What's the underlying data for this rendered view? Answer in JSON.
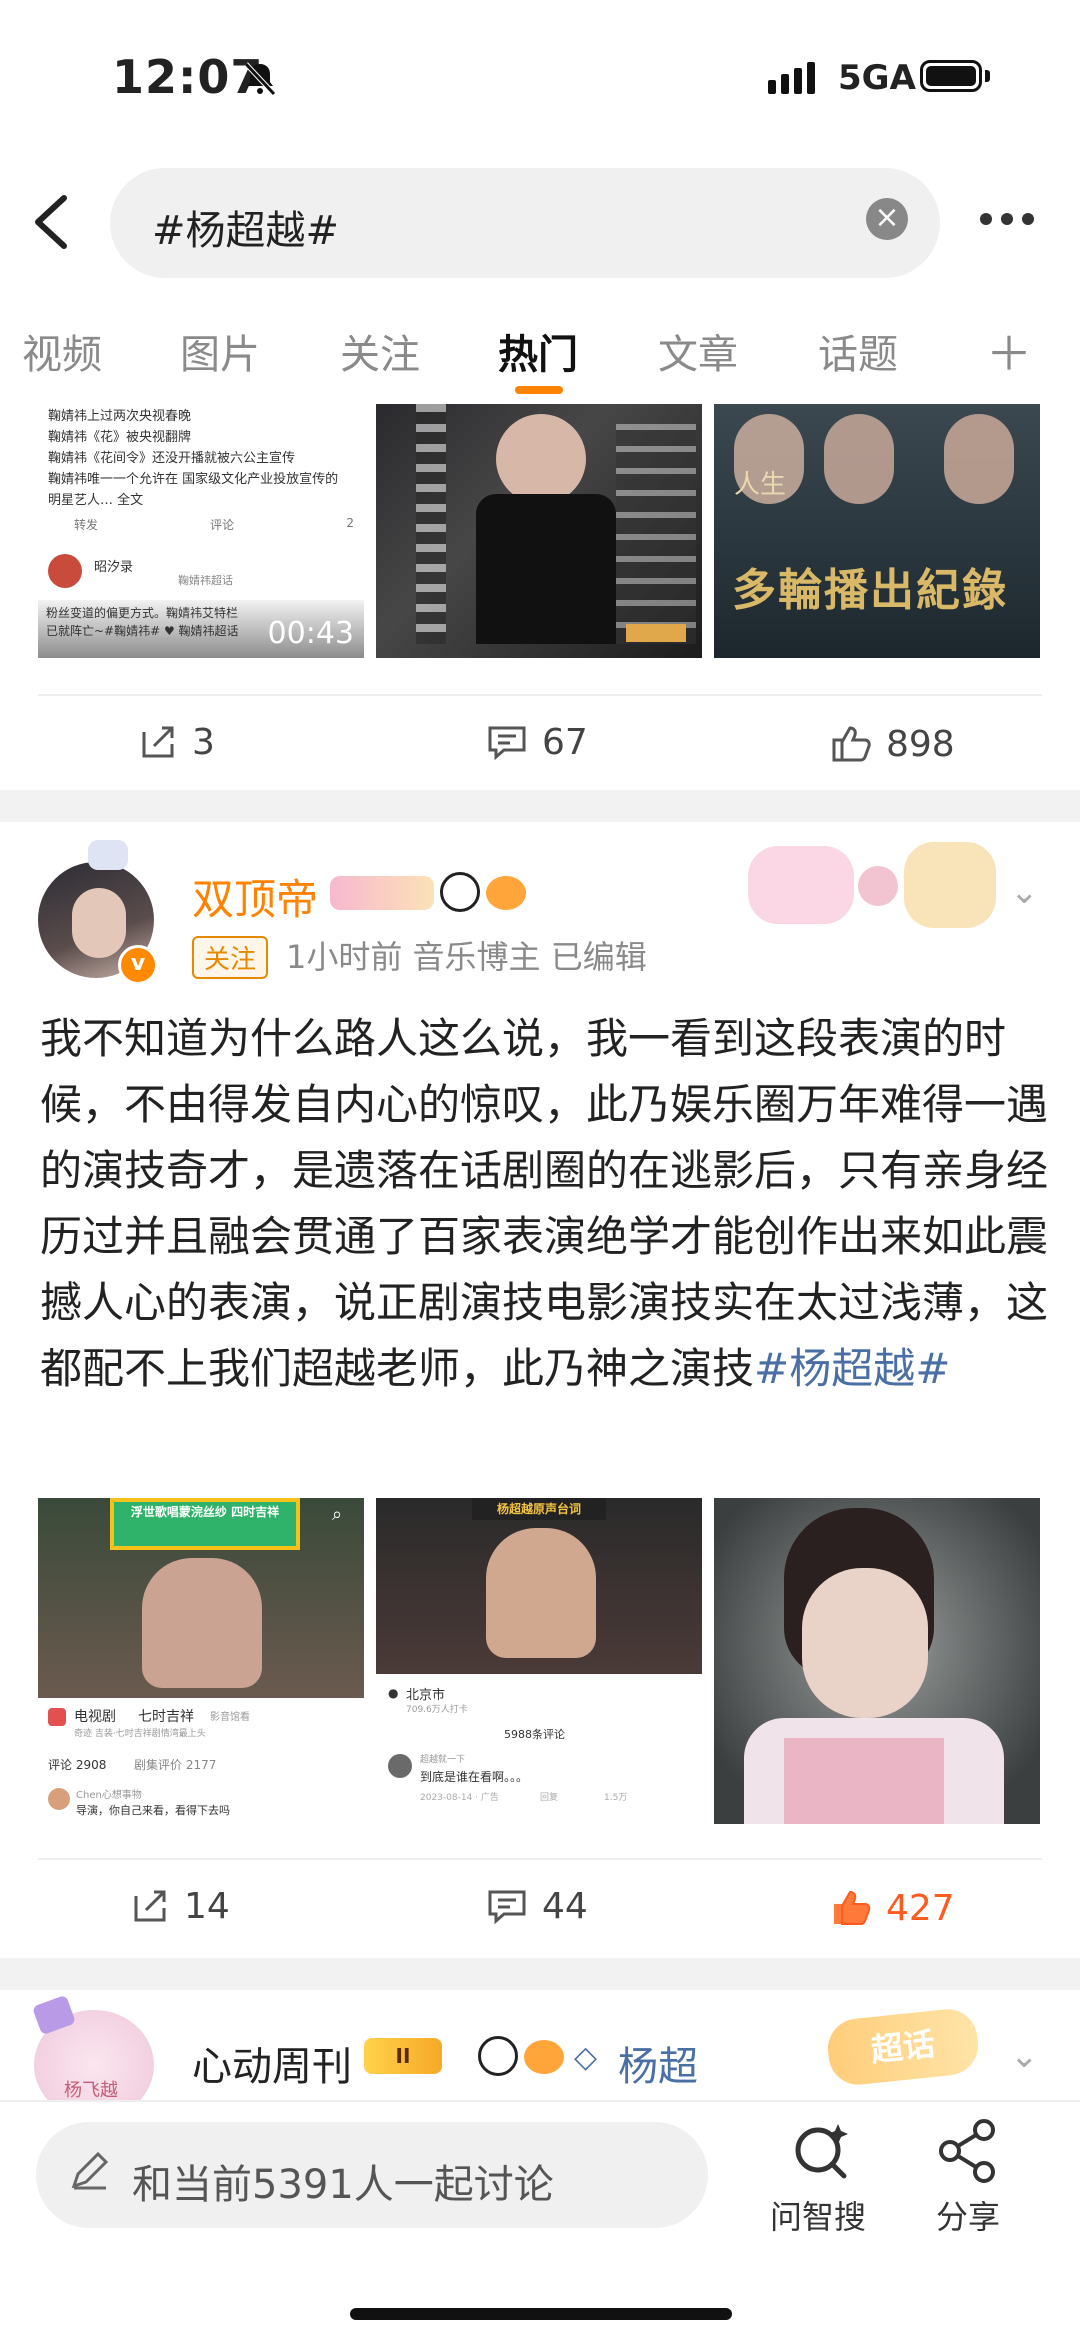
{
  "status": {
    "time": "12:07",
    "network": "5GA"
  },
  "search": {
    "query": "#杨超越#"
  },
  "tabs": [
    "视频",
    "图片",
    "关注",
    "热门",
    "文章",
    "话题"
  ],
  "active_tab": "热门",
  "post1": {
    "video_lines": [
      "鞠婧祎上过两次央视春晚",
      "鞠婧祎《花》被央视翻牌",
      "鞠婧祎《花间令》还没开播就被六公主宣传",
      "鞠婧祎唯一一个允许在 国家级文化产业投放宣传的",
      "明星艺人… 全文"
    ],
    "video_actions": [
      "转发",
      "评论",
      "2"
    ],
    "video_user": "昭汐录",
    "video_supertopic": "鞠婧祎超话",
    "video_caption": "粉丝变道的偏更方式。鞠婧祎艾特栏已就阵亡~#鞠婧祎# ♥ 鞠婧祎超话",
    "video_duration": "00:43",
    "poster_title": "多輪播出紀錄",
    "poster_subtitle": "人生",
    "actions": {
      "repost": "3",
      "comment": "67",
      "like": "898"
    }
  },
  "post2": {
    "username": "双顶帝",
    "follow_label": "关注",
    "meta": "1小时前  音乐博主  已编辑",
    "body_text": "我不知道为什么路人这么说，我一看到这段表演的时候，不由得发自内心的惊叹，此乃娱乐圈万年难得一遇的演技奇才，是遗落在话剧圈的在逃影后，只有亲身经历过并且融会贯通了百家表演绝学才能创作出来如此震撼人心的表演，说正剧演技电影演技实在太过浅薄，这都配不上我们超越老师，此乃神之演技",
    "hashtag": "#杨超越#",
    "image1": {
      "banner": "浮世歌唱蒙浣丝纱 四时吉祥",
      "app": "电视剧",
      "title": "七时吉祥",
      "tag": "影音馆看",
      "sub": "奇迹 吉装·七时吉祥剧情湾最上头",
      "tab1": "评论 2908",
      "tab2": "剧集评价 2177",
      "commenter": "Chen心想事物",
      "comment": "导演，你自己来看，看得下去吗"
    },
    "image2": {
      "banner": "杨超越原声台词",
      "city": "北京市",
      "visitors": "709.6万人打卡",
      "count": "5988条评论",
      "user": "超越就一下",
      "comment": "到底是谁在看啊。。。",
      "date": "2023-08-14 · 广告",
      "reply": "回复",
      "likes": "1.5万"
    },
    "actions": {
      "repost": "14",
      "comment": "44",
      "like": "427"
    },
    "colors": {
      "like_active": "#ff5a1f",
      "brand": "#ff8200"
    }
  },
  "post3": {
    "username": "心动周刊",
    "level": "II",
    "supertopic": "杨超",
    "badge": "超话",
    "avatar_label": "杨飞越"
  },
  "composer": {
    "placeholder": "和当前5391人一起讨论"
  },
  "bottom_actions": {
    "zhisou": "问智搜",
    "share": "分享"
  }
}
